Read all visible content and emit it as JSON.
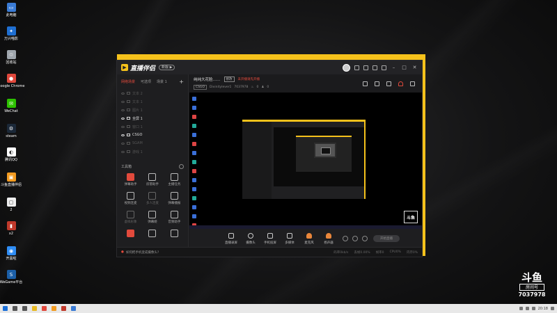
{
  "desktop": {
    "icons": [
      {
        "label": "此电脑",
        "color": "#3a7bd5",
        "glyph": "▭"
      },
      {
        "label": "万兴喵影",
        "color": "#1f6fd1",
        "glyph": "✦"
      },
      {
        "label": "回收站",
        "color": "#9fa6ad",
        "glyph": "♲"
      },
      {
        "label": "Google Chrome",
        "color": "#e0483c",
        "glyph": "●"
      },
      {
        "label": "WeChat",
        "color": "#2dc100",
        "glyph": "✉"
      },
      {
        "label": "steam",
        "color": "#1b2838",
        "glyph": "⚙"
      },
      {
        "label": "腾讯QQ",
        "color": "#ffffff",
        "glyph": "◐"
      },
      {
        "label": "斗鱼直播伴侣",
        "color": "#f29b21",
        "glyph": "▣"
      },
      {
        "label": "2",
        "color": "#eeeeee",
        "glyph": "▢"
      },
      {
        "label": "x2",
        "color": "#c0392b",
        "glyph": "▮"
      },
      {
        "label": "开黑啦",
        "color": "#2f8df5",
        "glyph": "◉"
      },
      {
        "label": "WeGame平台",
        "color": "#1b5fa7",
        "glyph": "S"
      }
    ]
  },
  "app": {
    "title": "直播伴侣",
    "version": "新版 ▶",
    "brand_color": "#f6c21b",
    "accent_color": "#e24a3c",
    "sidebar": {
      "tabs": [
        "网络场景",
        "可选项",
        "场景 1"
      ],
      "scenes": [
        {
          "label": "文本 2",
          "on": false
        },
        {
          "label": "文本 1",
          "on": false
        },
        {
          "label": "图片 1",
          "on": false
        },
        {
          "label": "全屏 1",
          "on": true
        },
        {
          "label": "窗口 1",
          "on": false
        },
        {
          "label": "CSGO",
          "on": true
        },
        {
          "label": "SGAM",
          "on": false
        },
        {
          "label": "游戏 1",
          "on": false
        }
      ],
      "toolbox_title": "工具箱",
      "tools": [
        {
          "label": "弹幕助手",
          "highlight": true,
          "dim": false
        },
        {
          "label": "房管助手",
          "highlight": false,
          "dim": false
        },
        {
          "label": "主播任务",
          "highlight": false,
          "dim": false
        },
        {
          "label": "视频连麦",
          "highlight": false,
          "dim": false
        },
        {
          "label": "多人连麦",
          "highlight": false,
          "dim": true
        },
        {
          "label": "弹幕播报",
          "highlight": false,
          "dim": false
        },
        {
          "label": "虚拟形象",
          "highlight": false,
          "dim": true
        },
        {
          "label": "弹幕姬",
          "highlight": false,
          "dim": false
        },
        {
          "label": "音频助手",
          "highlight": false,
          "dim": false
        },
        {
          "label": "",
          "highlight": true,
          "dim": false
        },
        {
          "label": "",
          "highlight": false,
          "dim": false
        },
        {
          "label": "",
          "highlight": false,
          "dim": false
        }
      ]
    },
    "room": {
      "title": "纯纯大花脸……",
      "tag": "修改",
      "notice": "未开播请先开播",
      "category": "CSGO",
      "streamer": "Divinitylever1",
      "room_id": "7037978",
      "hot": "0",
      "fans": "0"
    },
    "controls": [
      {
        "label": "直播录屏",
        "shape": "square"
      },
      {
        "label": "摄像头",
        "shape": "round"
      },
      {
        "label": "手机投屏",
        "shape": "square"
      },
      {
        "label": "多媒体",
        "shape": "square"
      },
      {
        "label": "麦克风",
        "shape": "mic"
      },
      {
        "label": "扬声器",
        "shape": "speaker"
      }
    ],
    "go_live": "开始直播",
    "status": {
      "hint": "如何把手机变成摄像头?",
      "stats": [
        "码率0kb/s",
        "丢帧0.00%",
        "帧率0",
        "CPU0%",
        "内存0%"
      ]
    }
  },
  "watermark": {
    "logo": "斗鱼",
    "subtitle": "房间号",
    "room_number": "7037978"
  },
  "taskbar": {
    "time": "20:18",
    "icons": [
      "start",
      "search",
      "task-view",
      "explorer",
      "chrome",
      "douyu",
      "game",
      "app"
    ]
  }
}
